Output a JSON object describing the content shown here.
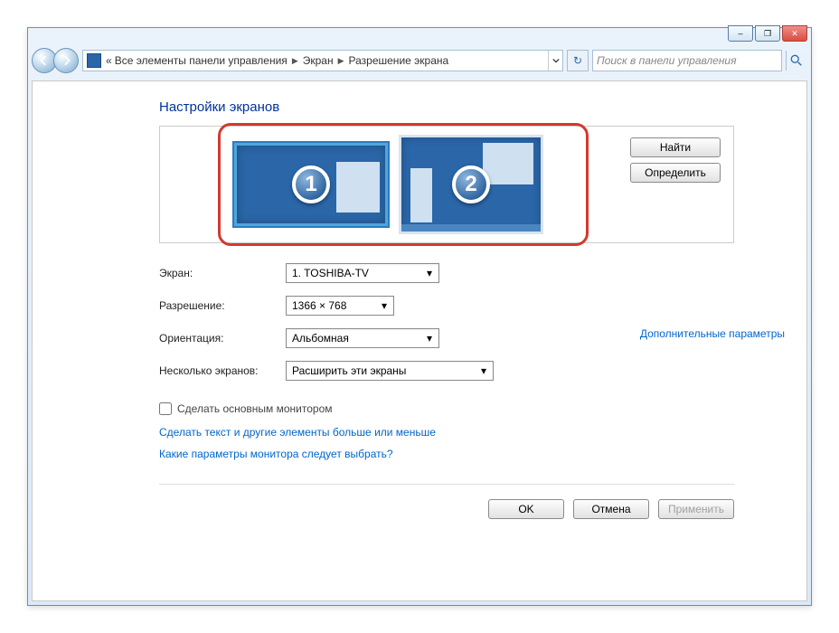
{
  "caption": {
    "minimize": "–",
    "maximize": "❐",
    "close": "✕"
  },
  "breadcrumb": {
    "prefix": "«",
    "items": [
      "Все элементы панели управления",
      "Экран",
      "Разрешение экрана"
    ]
  },
  "search": {
    "placeholder": "Поиск в панели управления"
  },
  "page_title": "Настройки экранов",
  "preview": {
    "monitors": [
      {
        "number": "1",
        "selected": true
      },
      {
        "number": "2",
        "selected": false
      }
    ],
    "buttons": {
      "find": "Найти",
      "identify": "Определить"
    }
  },
  "form": {
    "display_label": "Экран:",
    "display_value": "1. TOSHIBA-TV",
    "resolution_label": "Разрешение:",
    "resolution_value": "1366 × 768",
    "orientation_label": "Ориентация:",
    "orientation_value": "Альбомная",
    "multi_label": "Несколько экранов:",
    "multi_value": "Расширить эти экраны"
  },
  "checkbox": {
    "label": "Сделать основным монитором",
    "checked": false
  },
  "links": {
    "advanced": "Дополнительные параметры",
    "text_size": "Сделать текст и другие элементы больше или меньше",
    "help": "Какие параметры монитора следует выбрать?"
  },
  "dialog": {
    "ok": "OK",
    "cancel": "Отмена",
    "apply": "Применить"
  }
}
